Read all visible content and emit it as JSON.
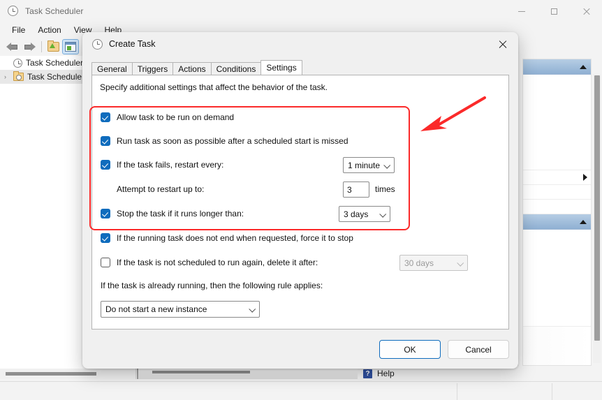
{
  "main_window": {
    "title": "Task Scheduler",
    "icon": "clock-icon",
    "window_controls": {
      "minimize": "–",
      "maximize": "□",
      "close": "✕"
    },
    "menu": [
      "File",
      "Action",
      "View",
      "Help"
    ],
    "toolbar": {
      "back": "back-arrow-icon",
      "forward": "forward-arrow-icon",
      "up_one_level": "folder-up-icon",
      "show_hide_pane": "show-action-pane-icon"
    },
    "tree": [
      {
        "label": "Task Scheduler (L",
        "icon": "clock-icon",
        "expander": "",
        "selected": false
      },
      {
        "label": "Task Schedule",
        "icon": "task-folder-icon",
        "expander": "›",
        "selected": true
      }
    ],
    "status": {
      "help_label": "Help",
      "help_icon": "help-question-icon"
    }
  },
  "dialog": {
    "title": "Create Task",
    "icon": "clock-icon",
    "close_icon": "close-icon",
    "tabs": [
      {
        "label": "General",
        "active": false
      },
      {
        "label": "Triggers",
        "active": false
      },
      {
        "label": "Actions",
        "active": false
      },
      {
        "label": "Conditions",
        "active": false
      },
      {
        "label": "Settings",
        "active": true
      }
    ],
    "description": "Specify additional settings that affect the behavior of the task.",
    "settings": [
      {
        "label": "Allow task to be run on demand",
        "checked": true,
        "control": null
      },
      {
        "label": "Run task as soon as possible after a scheduled start is missed",
        "checked": true,
        "control": null
      },
      {
        "label": "If the task fails, restart every:",
        "checked": true,
        "control": {
          "type": "combo",
          "value": "1 minute",
          "enabled": true
        }
      },
      {
        "label": "Attempt to restart up to:",
        "checked": null,
        "control": {
          "type": "textbox",
          "value": "3",
          "unit": "times",
          "enabled": true
        }
      },
      {
        "label": "Stop the task if it runs longer than:",
        "checked": true,
        "control": {
          "type": "combo",
          "value": "3 days",
          "enabled": true
        }
      },
      {
        "label": "If the running task does not end when requested, force it to stop",
        "checked": true,
        "control": null
      },
      {
        "label": "If the task is not scheduled to run again, delete it after:",
        "checked": false,
        "control": {
          "type": "combo",
          "value": "30 days",
          "enabled": false
        }
      }
    ],
    "rule_label": "If the task is already running, then the following rule applies:",
    "rule_value": "Do not start a new instance",
    "buttons": {
      "ok": "OK",
      "cancel": "Cancel"
    }
  },
  "annotation": {
    "highlight_color": "#fb2a2a",
    "arrow": "red-pointer-arrow"
  }
}
